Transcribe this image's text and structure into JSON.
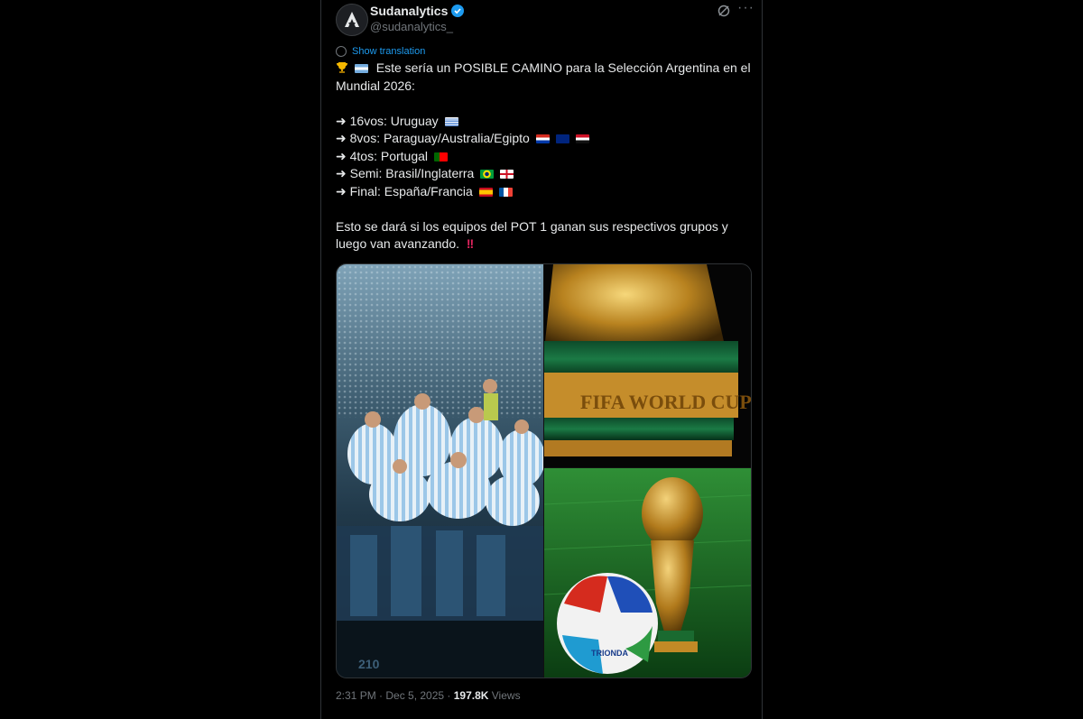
{
  "tweet": {
    "author_name": "Sudanalytics",
    "handle": "@sudanalytics_",
    "show_translation": "Show translation",
    "lines": [
      "Este sería un POSIBLE CAMINO para la Selección Argentina en el",
      "Mundial 2026:",
      "",
      "➜ 16vos: Uruguay",
      "➜ 8vos: Paraguay/Australia/Egipto",
      "➜ 4tos: Portugal",
      "➜ Semi: Brasil/Inglaterra",
      "➜ Final: España/Francia",
      "",
      "Esto se dará si los equipos del POT 1 ganan sus respectivos grupos y",
      "luego van avanzando."
    ],
    "trophy_text": "FIFA WORLD CUP",
    "ball_text": "TRIONDA",
    "shirt_number": "210",
    "time": "2:31 PM · Dec 5, 2025 · ",
    "views_count": "197.8K",
    "views_label": " Views"
  },
  "icons": {
    "avatar": "sudanalytics-logo-icon",
    "verified": "verified-badge-icon",
    "grok": "grok-icon",
    "more": "more-icon",
    "translate": "globe-icon"
  },
  "colors": {
    "accent": "#1d9bf0",
    "text": "#e7e9ea",
    "muted": "#71767b",
    "border": "#2f3336",
    "alert": "#e0245e"
  }
}
